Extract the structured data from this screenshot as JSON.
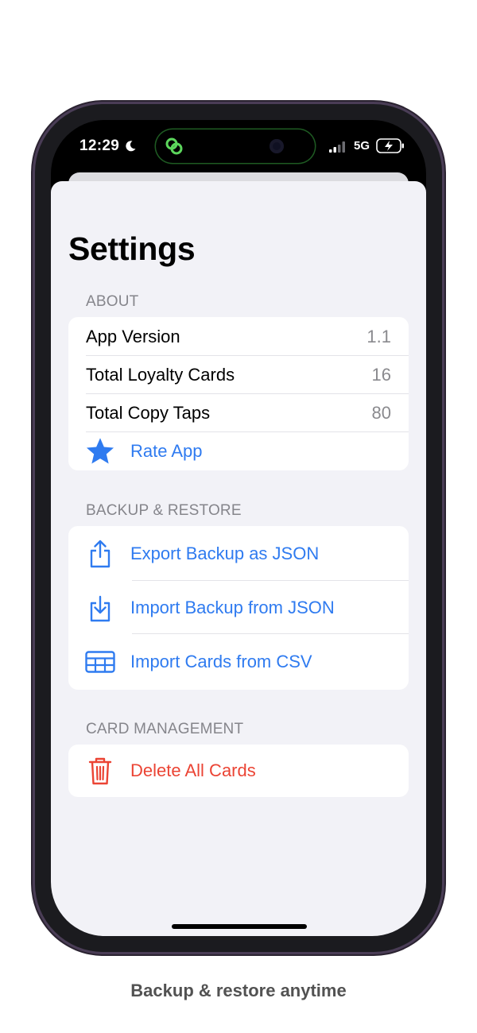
{
  "status_bar": {
    "time": "12:29",
    "network": "5G"
  },
  "page": {
    "title": "Settings"
  },
  "sections": {
    "about": {
      "header": "ABOUT",
      "app_version": {
        "label": "App Version",
        "value": "1.1"
      },
      "total_loyalty_cards": {
        "label": "Total Loyalty Cards",
        "value": "16"
      },
      "total_copy_taps": {
        "label": "Total Copy Taps",
        "value": "80"
      },
      "rate_app": {
        "label": "Rate App",
        "icon": "star-icon"
      }
    },
    "backup_restore": {
      "header": "BACKUP & RESTORE",
      "export_json": {
        "label": "Export Backup as JSON",
        "icon": "share-export-icon"
      },
      "import_json": {
        "label": "Import Backup from JSON",
        "icon": "download-import-icon"
      },
      "import_csv": {
        "label": "Import Cards from CSV",
        "icon": "table-grid-icon"
      }
    },
    "card_management": {
      "header": "CARD MANAGEMENT",
      "delete_all": {
        "label": "Delete All Cards",
        "icon": "trash-icon"
      }
    }
  },
  "colors": {
    "accent": "#2f7bf0",
    "destructive": "#eb4434",
    "background": "#f2f2f7"
  },
  "caption": "Backup & restore anytime"
}
